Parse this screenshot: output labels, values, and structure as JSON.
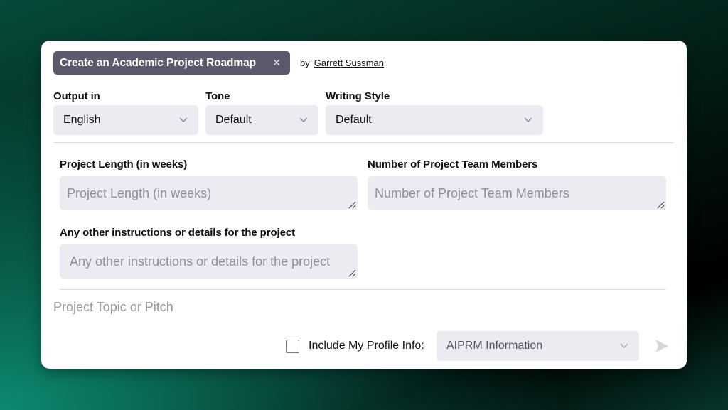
{
  "header": {
    "title": "Create an Academic Project Roadmap",
    "close_icon": "×",
    "by_label": "by",
    "author": "Garrett Sussman"
  },
  "options": {
    "output": {
      "label": "Output in",
      "value": "English"
    },
    "tone": {
      "label": "Tone",
      "value": "Default"
    },
    "style": {
      "label": "Writing Style",
      "value": "Default"
    }
  },
  "fields": {
    "length": {
      "label": "Project Length (in weeks)",
      "placeholder": "Project Length (in weeks)"
    },
    "members": {
      "label": "Number of Project Team Members",
      "placeholder": "Number of Project Team Members"
    },
    "details": {
      "label": "Any other instructions or details for the project",
      "placeholder": "Any other instructions or details for the project"
    }
  },
  "prompt": {
    "placeholder": "Project Topic or Pitch"
  },
  "footer": {
    "include_label": "Include",
    "profile_link": "My Profile Info",
    "colon": ":",
    "profile_select": "AIPRM Information",
    "checkbox_checked": false
  },
  "colors": {
    "chip_bg": "#5a5a6b",
    "input_bg": "#ebebf1",
    "placeholder": "#8f8f9c"
  }
}
